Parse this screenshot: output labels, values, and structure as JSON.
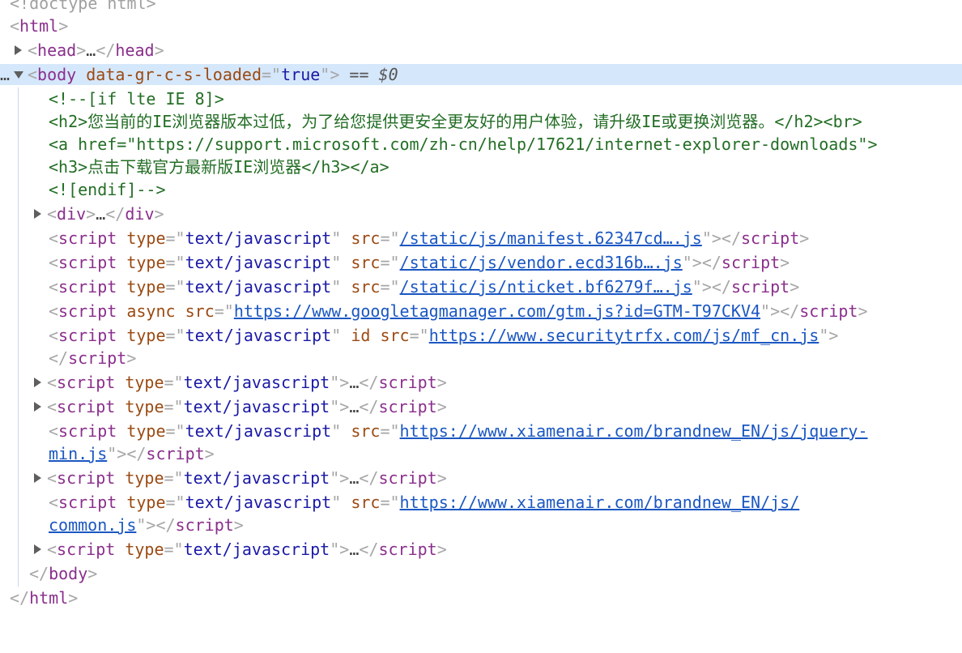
{
  "doctype": "<!doctype html>",
  "html_open": "html",
  "head_tag": "head",
  "ellipsis": "…",
  "selected_marker": "== $0",
  "gutter_marker": "…",
  "body": {
    "tag": "body",
    "attr_name": "data-gr-c-s-loaded",
    "attr_value": "true"
  },
  "comment": [
    "<!--[if lte IE 8]>",
    "<h2>您当前的IE浏览器版本过低，为了给您提供更安全更友好的用户体验，请升级IE或更换浏览器。</h2><br>",
    "<a href=\"https://support.microsoft.com/zh-cn/help/17621/internet-explorer-downloads\">",
    "<h3>点击下载官方最新版IE浏览器</h3></a>",
    "<![endif]-->"
  ],
  "div_tag": "div",
  "script": {
    "tag": "script",
    "type_attr": "type",
    "type_value": "text/javascript",
    "src_attr": "src",
    "async_attr": "async",
    "id_attr": "id",
    "srcs": [
      "/static/js/manifest.62347cd….js",
      "/static/js/vendor.ecd316b….js",
      "/static/js/nticket.bf6279f….js",
      "https://www.googletagmanager.com/gtm.js?id=GTM-T97CKV4",
      "https://www.securitytrfx.com/js/mf_cn.js",
      "https://www.xiamenair.com/brandnew_EN/js/jquery-",
      "min.js",
      "https://www.xiamenair.com/brandnew_EN/js/",
      "common.js"
    ]
  }
}
